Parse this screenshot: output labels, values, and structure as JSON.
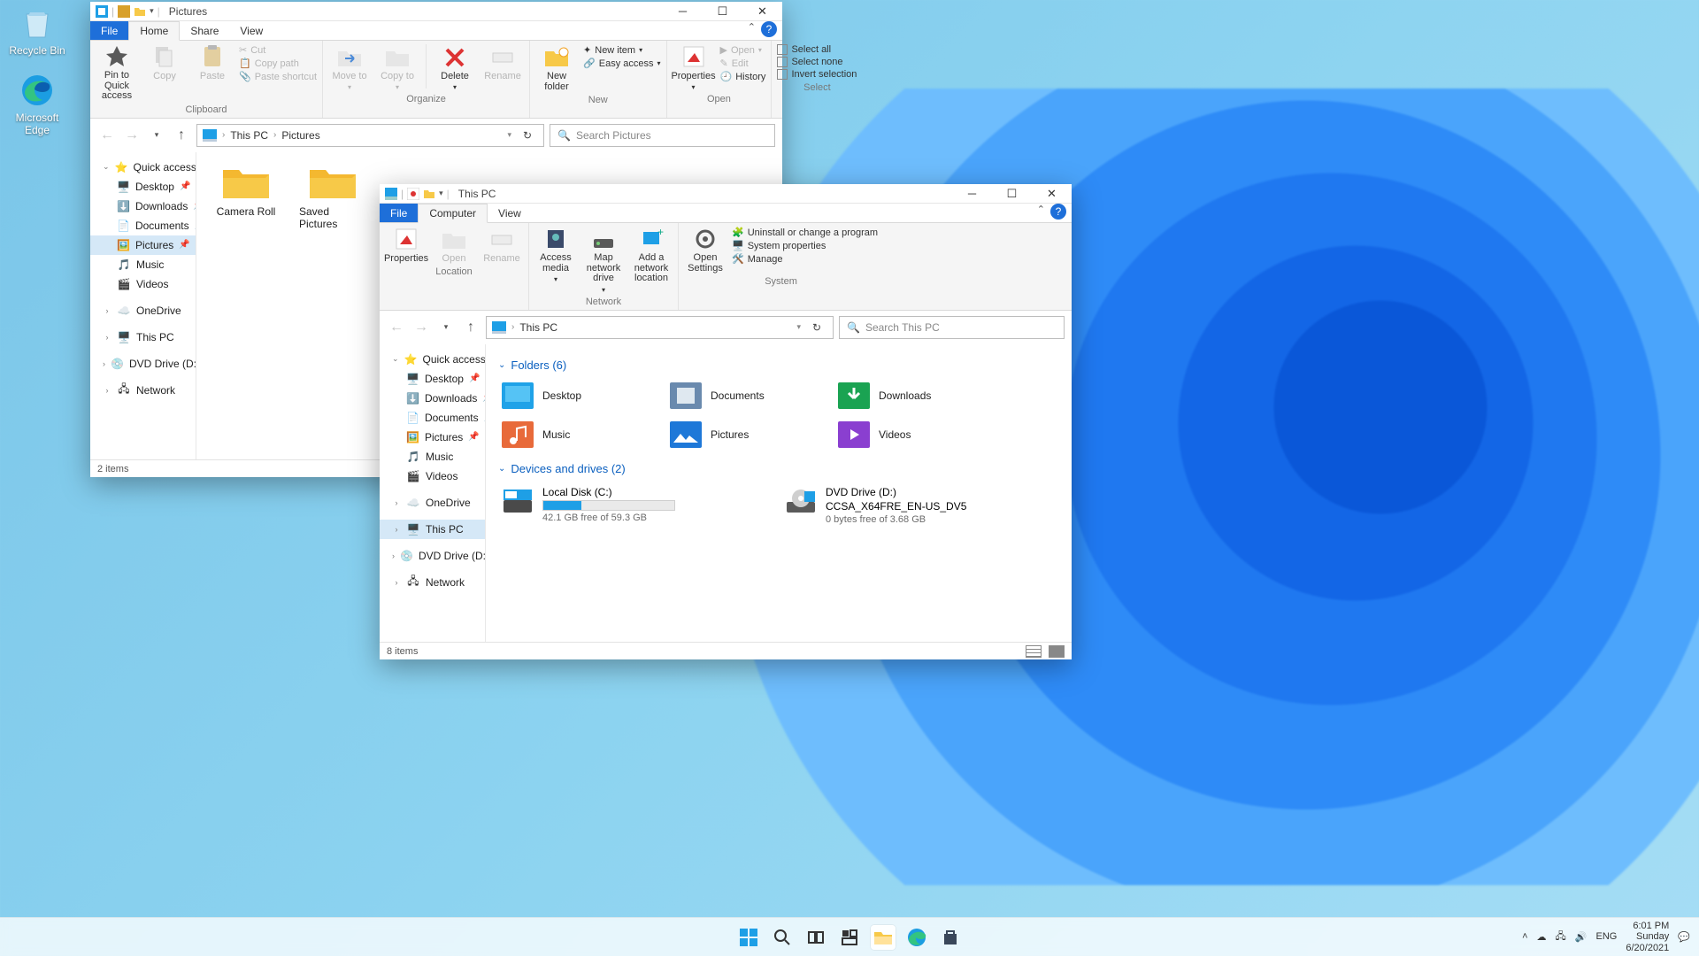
{
  "desktop": {
    "recycle": "Recycle Bin",
    "edge": "Microsoft Edge"
  },
  "window1": {
    "title": "Pictures",
    "tabs": {
      "file": "File",
      "home": "Home",
      "share": "Share",
      "view": "View"
    },
    "ribbon": {
      "clipboard": {
        "label": "Clipboard",
        "pin": "Pin to Quick access",
        "copy": "Copy",
        "paste": "Paste",
        "cut": "Cut",
        "copypath": "Copy path",
        "pasteshortcut": "Paste shortcut"
      },
      "organize": {
        "label": "Organize",
        "moveto": "Move to",
        "copyto": "Copy to",
        "delete": "Delete",
        "rename": "Rename"
      },
      "new": {
        "label": "New",
        "newfolder": "New folder",
        "newitem": "New item",
        "easyaccess": "Easy access"
      },
      "open": {
        "label": "Open",
        "properties": "Properties",
        "open": "Open",
        "edit": "Edit",
        "history": "History"
      },
      "select": {
        "label": "Select",
        "all": "Select all",
        "none": "Select none",
        "invert": "Invert selection"
      }
    },
    "breadcrumb": {
      "root": "This PC",
      "leaf": "Pictures"
    },
    "search_placeholder": "Search Pictures",
    "nav": {
      "quick": "Quick access",
      "desktop": "Desktop",
      "downloads": "Downloads",
      "documents": "Documents",
      "pictures": "Pictures",
      "music": "Music",
      "videos": "Videos",
      "onedrive": "OneDrive",
      "thispc": "This PC",
      "dvd": "DVD Drive (D:) CCSA",
      "network": "Network"
    },
    "items": {
      "cameraroll": "Camera Roll",
      "savedpictures": "Saved Pictures"
    },
    "status": "2 items"
  },
  "window2": {
    "title": "This PC",
    "tabs": {
      "file": "File",
      "computer": "Computer",
      "view": "View"
    },
    "ribbon": {
      "location": {
        "label": "Location",
        "properties": "Properties",
        "open": "Open",
        "rename": "Rename"
      },
      "network": {
        "label": "Network",
        "accessmedia": "Access media",
        "mapdrive": "Map network drive",
        "addlocation": "Add a network location"
      },
      "system": {
        "label": "System",
        "opensettings": "Open Settings",
        "uninstall": "Uninstall or change a program",
        "sysprops": "System properties",
        "manage": "Manage"
      }
    },
    "breadcrumb": {
      "root": "This PC"
    },
    "search_placeholder": "Search This PC",
    "nav": {
      "quick": "Quick access",
      "desktop": "Desktop",
      "downloads": "Downloads",
      "documents": "Documents",
      "pictures": "Pictures",
      "music": "Music",
      "videos": "Videos",
      "onedrive": "OneDrive",
      "thispc": "This PC",
      "dvd": "DVD Drive (D:) CCSA",
      "network": "Network"
    },
    "sections": {
      "folders": "Folders (6)",
      "devices": "Devices and drives (2)"
    },
    "folders": {
      "desktop": "Desktop",
      "documents": "Documents",
      "downloads": "Downloads",
      "music": "Music",
      "pictures": "Pictures",
      "videos": "Videos"
    },
    "drives": {
      "c": {
        "name": "Local Disk (C:)",
        "free": "42.1 GB free of 59.3 GB",
        "fill_pct": 29
      },
      "d": {
        "name": "DVD Drive (D:)",
        "label": "CCSA_X64FRE_EN-US_DV5",
        "free": "0 bytes free of 3.68 GB"
      }
    },
    "status": "8 items"
  },
  "taskbar": {
    "lang": "ENG",
    "time": "6:01 PM",
    "day": "Sunday",
    "date": "6/20/2021"
  }
}
